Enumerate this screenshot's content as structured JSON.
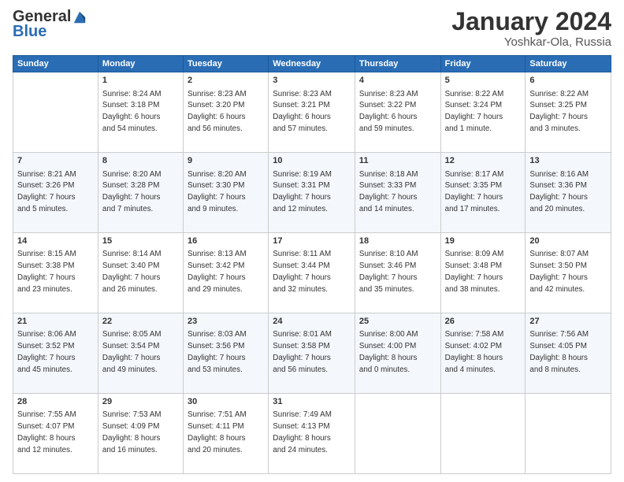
{
  "header": {
    "logo_general": "General",
    "logo_blue": "Blue",
    "month_title": "January 2024",
    "subtitle": "Yoshkar-Ola, Russia"
  },
  "weekdays": [
    "Sunday",
    "Monday",
    "Tuesday",
    "Wednesday",
    "Thursday",
    "Friday",
    "Saturday"
  ],
  "weeks": [
    [
      {
        "day": "",
        "info": ""
      },
      {
        "day": "1",
        "info": "Sunrise: 8:24 AM\nSunset: 3:18 PM\nDaylight: 6 hours\nand 54 minutes."
      },
      {
        "day": "2",
        "info": "Sunrise: 8:23 AM\nSunset: 3:20 PM\nDaylight: 6 hours\nand 56 minutes."
      },
      {
        "day": "3",
        "info": "Sunrise: 8:23 AM\nSunset: 3:21 PM\nDaylight: 6 hours\nand 57 minutes."
      },
      {
        "day": "4",
        "info": "Sunrise: 8:23 AM\nSunset: 3:22 PM\nDaylight: 6 hours\nand 59 minutes."
      },
      {
        "day": "5",
        "info": "Sunrise: 8:22 AM\nSunset: 3:24 PM\nDaylight: 7 hours\nand 1 minute."
      },
      {
        "day": "6",
        "info": "Sunrise: 8:22 AM\nSunset: 3:25 PM\nDaylight: 7 hours\nand 3 minutes."
      }
    ],
    [
      {
        "day": "7",
        "info": "Sunrise: 8:21 AM\nSunset: 3:26 PM\nDaylight: 7 hours\nand 5 minutes."
      },
      {
        "day": "8",
        "info": "Sunrise: 8:20 AM\nSunset: 3:28 PM\nDaylight: 7 hours\nand 7 minutes."
      },
      {
        "day": "9",
        "info": "Sunrise: 8:20 AM\nSunset: 3:30 PM\nDaylight: 7 hours\nand 9 minutes."
      },
      {
        "day": "10",
        "info": "Sunrise: 8:19 AM\nSunset: 3:31 PM\nDaylight: 7 hours\nand 12 minutes."
      },
      {
        "day": "11",
        "info": "Sunrise: 8:18 AM\nSunset: 3:33 PM\nDaylight: 7 hours\nand 14 minutes."
      },
      {
        "day": "12",
        "info": "Sunrise: 8:17 AM\nSunset: 3:35 PM\nDaylight: 7 hours\nand 17 minutes."
      },
      {
        "day": "13",
        "info": "Sunrise: 8:16 AM\nSunset: 3:36 PM\nDaylight: 7 hours\nand 20 minutes."
      }
    ],
    [
      {
        "day": "14",
        "info": "Sunrise: 8:15 AM\nSunset: 3:38 PM\nDaylight: 7 hours\nand 23 minutes."
      },
      {
        "day": "15",
        "info": "Sunrise: 8:14 AM\nSunset: 3:40 PM\nDaylight: 7 hours\nand 26 minutes."
      },
      {
        "day": "16",
        "info": "Sunrise: 8:13 AM\nSunset: 3:42 PM\nDaylight: 7 hours\nand 29 minutes."
      },
      {
        "day": "17",
        "info": "Sunrise: 8:11 AM\nSunset: 3:44 PM\nDaylight: 7 hours\nand 32 minutes."
      },
      {
        "day": "18",
        "info": "Sunrise: 8:10 AM\nSunset: 3:46 PM\nDaylight: 7 hours\nand 35 minutes."
      },
      {
        "day": "19",
        "info": "Sunrise: 8:09 AM\nSunset: 3:48 PM\nDaylight: 7 hours\nand 38 minutes."
      },
      {
        "day": "20",
        "info": "Sunrise: 8:07 AM\nSunset: 3:50 PM\nDaylight: 7 hours\nand 42 minutes."
      }
    ],
    [
      {
        "day": "21",
        "info": "Sunrise: 8:06 AM\nSunset: 3:52 PM\nDaylight: 7 hours\nand 45 minutes."
      },
      {
        "day": "22",
        "info": "Sunrise: 8:05 AM\nSunset: 3:54 PM\nDaylight: 7 hours\nand 49 minutes."
      },
      {
        "day": "23",
        "info": "Sunrise: 8:03 AM\nSunset: 3:56 PM\nDaylight: 7 hours\nand 53 minutes."
      },
      {
        "day": "24",
        "info": "Sunrise: 8:01 AM\nSunset: 3:58 PM\nDaylight: 7 hours\nand 56 minutes."
      },
      {
        "day": "25",
        "info": "Sunrise: 8:00 AM\nSunset: 4:00 PM\nDaylight: 8 hours\nand 0 minutes."
      },
      {
        "day": "26",
        "info": "Sunrise: 7:58 AM\nSunset: 4:02 PM\nDaylight: 8 hours\nand 4 minutes."
      },
      {
        "day": "27",
        "info": "Sunrise: 7:56 AM\nSunset: 4:05 PM\nDaylight: 8 hours\nand 8 minutes."
      }
    ],
    [
      {
        "day": "28",
        "info": "Sunrise: 7:55 AM\nSunset: 4:07 PM\nDaylight: 8 hours\nand 12 minutes."
      },
      {
        "day": "29",
        "info": "Sunrise: 7:53 AM\nSunset: 4:09 PM\nDaylight: 8 hours\nand 16 minutes."
      },
      {
        "day": "30",
        "info": "Sunrise: 7:51 AM\nSunset: 4:11 PM\nDaylight: 8 hours\nand 20 minutes."
      },
      {
        "day": "31",
        "info": "Sunrise: 7:49 AM\nSunset: 4:13 PM\nDaylight: 8 hours\nand 24 minutes."
      },
      {
        "day": "",
        "info": ""
      },
      {
        "day": "",
        "info": ""
      },
      {
        "day": "",
        "info": ""
      }
    ]
  ]
}
